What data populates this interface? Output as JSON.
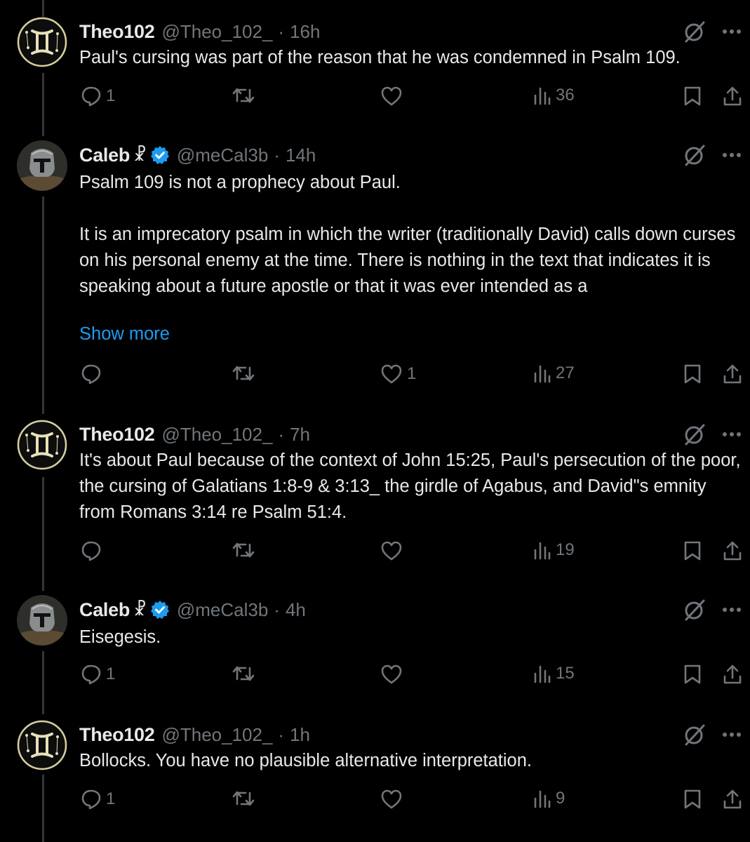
{
  "tweets": [
    {
      "name": "Theo102",
      "name_emoji": "",
      "verified": false,
      "handle": "@Theo_102_",
      "time": "16h",
      "avatar": "gemini-avatar",
      "text": "Paul's cursing was part of the reason that he was condemned in Psalm 109.",
      "show_more": "",
      "replies": "1",
      "retweets": "",
      "likes": "",
      "views": "36"
    },
    {
      "name": "Caleb",
      "name_emoji": "☧",
      "verified": true,
      "handle": "@meCal3b",
      "time": "14h",
      "avatar": "helmet-avatar",
      "text": "Psalm 109 is not a prophecy about Paul.\n\nIt is an imprecatory psalm in which the writer (traditionally David) calls down curses on his personal enemy at the time. There is nothing in the text that indicates it is speaking about a future apostle or that it was ever intended as a",
      "show_more": "Show more",
      "replies": "",
      "retweets": "",
      "likes": "1",
      "views": "27"
    },
    {
      "name": "Theo102",
      "name_emoji": "",
      "verified": false,
      "handle": "@Theo_102_",
      "time": "7h",
      "avatar": "gemini-avatar",
      "text": "It's about Paul because of the context of John 15:25, Paul's persecution of the poor, the cursing of Galatians 1:8-9 & 3:13_ the girdle of Agabus, and David\"s emnity from Romans 3:14 re Psalm 51:4.",
      "show_more": "",
      "replies": "",
      "retweets": "",
      "likes": "",
      "views": "19"
    },
    {
      "name": "Caleb",
      "name_emoji": "☧",
      "verified": true,
      "handle": "@meCal3b",
      "time": "4h",
      "avatar": "helmet-avatar",
      "text": "Eisegesis.",
      "show_more": "",
      "replies": "1",
      "retweets": "",
      "likes": "",
      "views": "15"
    },
    {
      "name": "Theo102",
      "name_emoji": "",
      "verified": false,
      "handle": "@Theo_102_",
      "time": "1h",
      "avatar": "gemini-avatar",
      "text": "Bollocks. You have no plausible alternative interpretation.",
      "show_more": "",
      "replies": "1",
      "retweets": "",
      "likes": "",
      "views": "9"
    }
  ],
  "colors": {
    "background": "#000000",
    "text": "#e7e9ea",
    "muted": "#71767b",
    "link": "#1d9bf0",
    "verified": "#1d9bf0"
  }
}
